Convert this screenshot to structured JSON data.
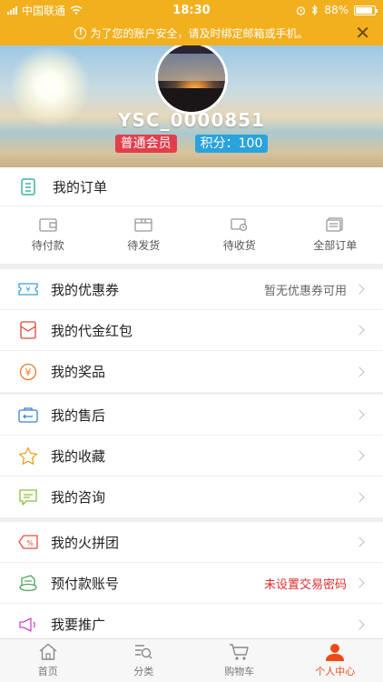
{
  "status_bar": {
    "carrier": "中国联通",
    "time": "18:30",
    "battery": "88%"
  },
  "notice": {
    "text": "为了您的账户安全，请及时绑定邮箱或手机。",
    "icon": "info-icon",
    "close_icon": "close-icon"
  },
  "profile": {
    "username": "YSC_0000851",
    "member_level": "普通会员",
    "points": "积分：100"
  },
  "orders": {
    "title": "我的订单",
    "items": [
      {
        "label": "待付款",
        "icon": "wallet-icon"
      },
      {
        "label": "待发货",
        "icon": "box-icon"
      },
      {
        "label": "待收货",
        "icon": "truck-icon"
      },
      {
        "label": "全部订单",
        "icon": "list-icon"
      }
    ]
  },
  "group1": [
    {
      "label": "我的优惠券",
      "value": "暂无优惠券可用",
      "icon": "coupon-icon"
    },
    {
      "label": "我的代金红包",
      "value": "",
      "icon": "red-envelope-icon"
    },
    {
      "label": "我的奖品",
      "value": "",
      "icon": "prize-icon"
    }
  ],
  "group2": [
    {
      "label": "我的售后",
      "value": "",
      "icon": "after-sale-icon"
    },
    {
      "label": "我的收藏",
      "value": "",
      "icon": "star-icon"
    },
    {
      "label": "我的咨询",
      "value": "",
      "icon": "chat-icon"
    }
  ],
  "group3": [
    {
      "label": "我的火拼团",
      "value": "",
      "icon": "group-buy-icon"
    },
    {
      "label": "预付款账号",
      "value": "未设置交易密码",
      "icon": "prepay-icon"
    },
    {
      "label": "我要推广",
      "value": "",
      "icon": "promote-icon"
    }
  ],
  "tabbar": [
    {
      "label": "首页",
      "icon": "home-icon"
    },
    {
      "label": "分类",
      "icon": "category-icon"
    },
    {
      "label": "购物车",
      "icon": "cart-icon"
    },
    {
      "label": "个人中心",
      "icon": "user-icon",
      "active": true
    }
  ],
  "colors": {
    "accent": "#f2b01e",
    "active_tab": "#f04a14",
    "member_badge": "#e23e4c",
    "points_badge": "#2aa3dd"
  }
}
